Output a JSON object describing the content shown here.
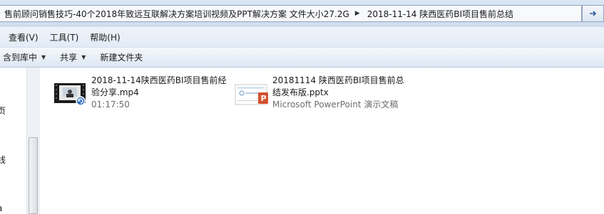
{
  "address_bar": {
    "crumbs": [
      "售前顾问销售技巧-40个2018年致远互联解决方案培训视频及PPT解决方案 文件大小27.2G",
      "2018-11-14 陕西医药BI项目售前总结"
    ],
    "separator": "▶"
  },
  "menu": {
    "items": [
      "查看(V)",
      "工具(T)",
      "帮助(H)"
    ]
  },
  "command_bar": {
    "include_library": "含到库中",
    "share": "共享",
    "new_folder": "新建文件夹"
  },
  "nav_pane": {
    "fragments": [
      "页",
      "线",
      "a"
    ]
  },
  "files": [
    {
      "name_line1": "2018-11-14陕西医药BI项目售前经",
      "name_line2": "验分享.mp4",
      "meta": "01:17:50",
      "icon": "video-file-icon"
    },
    {
      "name_line1": "20181114 陕西医药BI项目售前总",
      "name_line2": "结发布版.pptx",
      "meta": "Microsoft PowerPoint 演示文稿",
      "icon": "powerpoint-file-icon"
    }
  ],
  "colors": {
    "chrome_top": "#dbe6f4",
    "pptx_orange": "#d35230"
  }
}
